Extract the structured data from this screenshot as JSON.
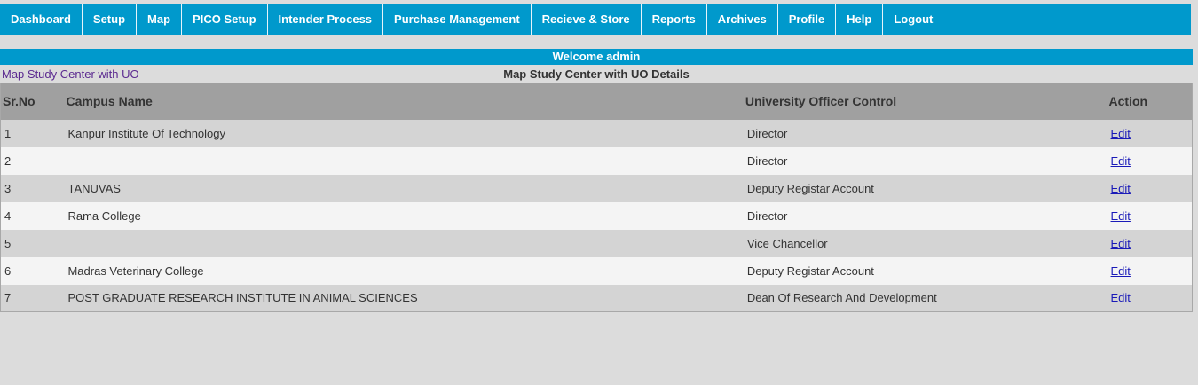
{
  "nav": {
    "items": [
      "Dashboard",
      "Setup",
      "Map",
      "PICO Setup",
      "Intender Process",
      "Purchase Management",
      "Recieve & Store",
      "Reports",
      "Archives",
      "Profile",
      "Help",
      "Logout"
    ]
  },
  "welcome": "Welcome admin",
  "breadcrumb_link": "Map Study Center with UO",
  "section_title": "Map Study Center with UO Details",
  "table": {
    "headers": [
      "Sr.No",
      "Campus Name",
      "University Officer Control",
      "Action"
    ],
    "rows": [
      {
        "sr": "1",
        "campus": "Kanpur Institute Of Technology",
        "uo": "Director",
        "action": "Edit"
      },
      {
        "sr": "2",
        "campus": "",
        "uo": "Director",
        "action": "Edit"
      },
      {
        "sr": "3",
        "campus": "TANUVAS",
        "uo": "Deputy Registar Account",
        "action": "Edit"
      },
      {
        "sr": "4",
        "campus": "Rama College",
        "uo": "Director",
        "action": "Edit"
      },
      {
        "sr": "5",
        "campus": "",
        "uo": "Vice Chancellor",
        "action": "Edit"
      },
      {
        "sr": "6",
        "campus": "Madras Veterinary College",
        "uo": "Deputy Registar Account",
        "action": "Edit"
      },
      {
        "sr": "7",
        "campus": "POST GRADUATE RESEARCH INSTITUTE IN ANIMAL SCIENCES",
        "uo": "Dean Of Research And Development",
        "action": "Edit"
      }
    ]
  },
  "colors": {
    "nav_bg": "#0099cc",
    "header_bg": "#a0a0a0",
    "row_odd": "#d4d4d4",
    "row_even": "#f4f4f4",
    "link": "#1a1ab8"
  }
}
